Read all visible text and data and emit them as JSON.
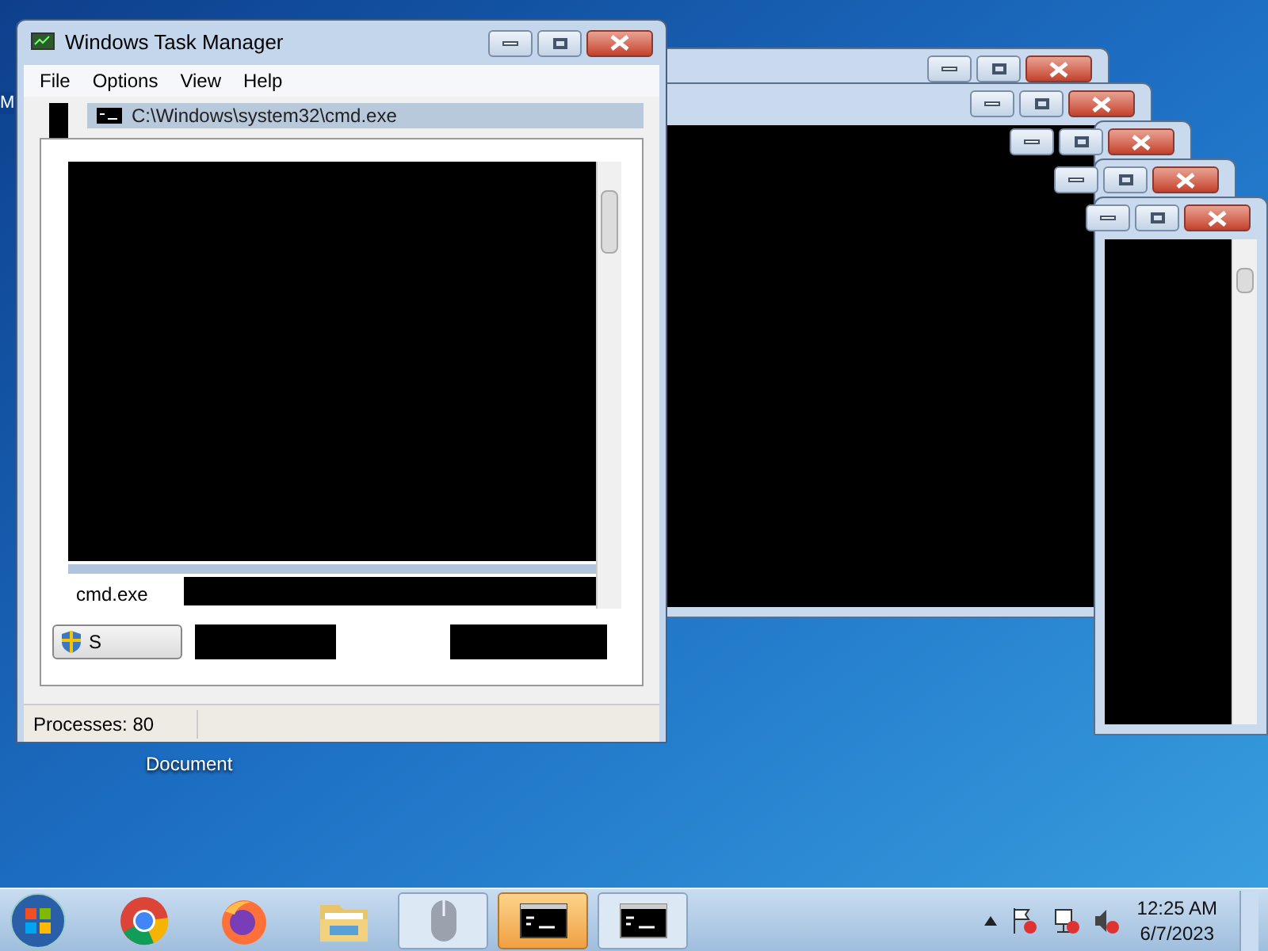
{
  "desktop": {
    "icons": [
      {
        "label": "M"
      },
      {
        "label": "Document"
      }
    ]
  },
  "console_windows": [
    {
      "kind": "console"
    },
    {
      "kind": "console"
    },
    {
      "kind": "console"
    },
    {
      "kind": "console"
    },
    {
      "kind": "console"
    }
  ],
  "task_manager": {
    "title": "Windows Task Manager",
    "menu": [
      "File",
      "Options",
      "View",
      "Help"
    ],
    "inner_title": "C:\\Windows\\system32\\cmd.exe",
    "process_row": "cmd.exe",
    "button_label": "S",
    "status": "Processes: 80"
  },
  "taskbar": {
    "items": [
      {
        "kind": "chrome",
        "selected": false
      },
      {
        "kind": "firefox",
        "selected": false
      },
      {
        "kind": "folder",
        "selected": false
      },
      {
        "kind": "mouse",
        "selected": false
      },
      {
        "kind": "console",
        "selected": true
      },
      {
        "kind": "console",
        "selected": false
      }
    ],
    "time": "12:25 AM",
    "date": "6/7/2023"
  }
}
